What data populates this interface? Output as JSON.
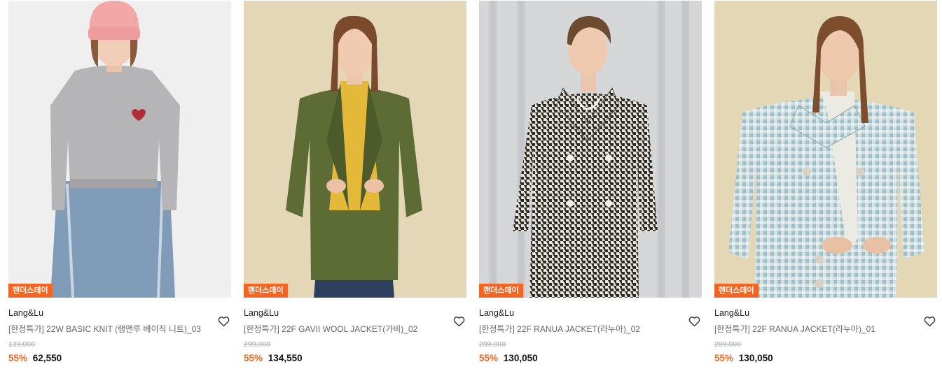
{
  "products": [
    {
      "badge": "랜더스데이",
      "brand": "Lang&Lu",
      "title": "[한정특가] 22W BASIC KNIT (랭앤루 베이직 니트)_03",
      "original_price": "139,000",
      "discount": "55%",
      "sale_price": "62,550"
    },
    {
      "badge": "랜더스데이",
      "brand": "Lang&Lu",
      "title": "[한정특가] 22F GAVII WOOL JACKET(가비)_02",
      "original_price": "299,000",
      "discount": "55%",
      "sale_price": "134,550"
    },
    {
      "badge": "랜더스데이",
      "brand": "Lang&Lu",
      "title": "[한정특가] 22F RANUA JACKET(라누아)_02",
      "original_price": "289,000",
      "discount": "55%",
      "sale_price": "130,050"
    },
    {
      "badge": "랜더스데이",
      "brand": "Lang&Lu",
      "title": "[한정특가] 22F RANUA JACKET(라누아)_01",
      "original_price": "289,000",
      "discount": "55%",
      "sale_price": "130,050"
    }
  ],
  "colors": {
    "accent": "#f26522",
    "text": "#222222",
    "muted": "#666666",
    "strike": "#aaaaaa"
  },
  "icons": {
    "wishlist": "heart-outline-icon"
  }
}
